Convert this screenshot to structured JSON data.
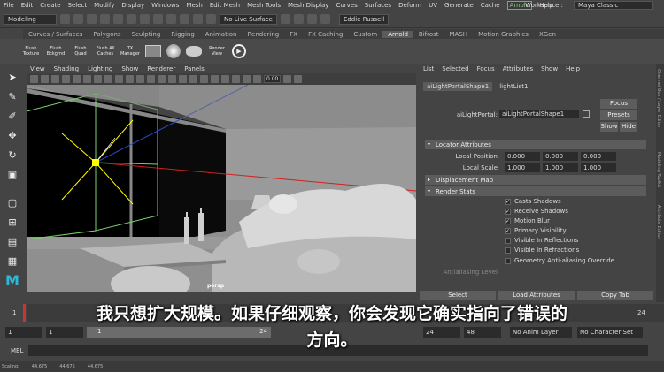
{
  "menubar": {
    "items": [
      "File",
      "Edit",
      "Create",
      "Select",
      "Modify",
      "Display",
      "Windows",
      "Mesh",
      "Edit Mesh",
      "Mesh Tools",
      "Mesh Display",
      "Curves",
      "Surfaces",
      "Deform",
      "UV",
      "Generate",
      "Cache"
    ],
    "arnold": "Arnold",
    "help": "Help",
    "workspace_label": "Workspace :",
    "workspace_value": "Maya Classic"
  },
  "statusline": {
    "mode": "Modeling",
    "live_surface": "No Live Surface",
    "user": "Eddie Russell"
  },
  "shelf": {
    "tabs": [
      "Curves / Surfaces",
      "Polygons",
      "Sculpting",
      "Rigging",
      "Animation",
      "Rendering",
      "FX",
      "FX Caching",
      "Custom",
      "Arnold",
      "Bifrost",
      "MASH",
      "Motion Graphics",
      "XGen"
    ],
    "active_tab": "Arnold",
    "buttons": [
      "Flush Texture",
      "Flush Bckgrnd",
      "Flush Quad",
      "Flush All Caches",
      "TX Manager",
      "",
      "",
      "",
      "Render View",
      ""
    ]
  },
  "viewport": {
    "menus": [
      "View",
      "Shading",
      "Lighting",
      "Show",
      "Renderer",
      "Panels"
    ],
    "field_value": "0.00",
    "camera_label": "persp"
  },
  "attribute_editor": {
    "menus": [
      "List",
      "Selected",
      "Focus",
      "Attributes",
      "Show",
      "Help"
    ],
    "tabs": [
      "aiLightPortalShape1",
      "lightList1"
    ],
    "node_label": "aiLightPortal:",
    "node_value": "aiLightPortalShape1",
    "buttons": {
      "focus": "Focus",
      "presets": "Presets",
      "show": "Show",
      "hide": "Hide"
    },
    "sections": {
      "locator": "Locator Attributes",
      "displacement": "Displacement Map",
      "render_stats": "Render Stats"
    },
    "local_position": {
      "label": "Local Position",
      "values": [
        "0.000",
        "0.000",
        "0.000"
      ]
    },
    "local_scale": {
      "label": "Local Scale",
      "values": [
        "1.000",
        "1.000",
        "1.000"
      ]
    },
    "render_stats": [
      {
        "label": "Casts Shadows",
        "checked": true
      },
      {
        "label": "Receive Shadows",
        "checked": true
      },
      {
        "label": "Motion Blur",
        "checked": true
      },
      {
        "label": "Primary Visibility",
        "checked": true
      },
      {
        "label": "Visible In Reflections",
        "checked": false
      },
      {
        "label": "Visible In Refractions",
        "checked": false
      },
      {
        "label": "Geometry Anti-aliasing Override",
        "checked": false
      }
    ],
    "antialiasing_label": "Antialiasing Level",
    "bottom_buttons": [
      "Select",
      "Load Attributes",
      "Copy Tab"
    ]
  },
  "side_tabs": [
    "Channel Box / Layer Editor",
    "Modeling Toolkit",
    "Attribute Editor"
  ],
  "timeline": {
    "ticks": [
      "1",
      "24"
    ]
  },
  "range": {
    "start": "1",
    "start2": "1",
    "slider_start": "1",
    "slider_end": "24",
    "end": "24",
    "end2": "48",
    "anim_layer": "No Anim Layer",
    "character_set": "No Character Set"
  },
  "mel": {
    "label": "MEL"
  },
  "helpline": {
    "items": [
      "Scaling:",
      "44.675",
      "44.675",
      "44.675"
    ]
  },
  "subtitles": {
    "line1": "我只想扩大规模。如果仔细观察，你会发现它确实指向了错误的",
    "line2": "方向。"
  },
  "colors": {
    "accent_arnold": "#8c8",
    "locator_yellow": "#ffff00"
  }
}
